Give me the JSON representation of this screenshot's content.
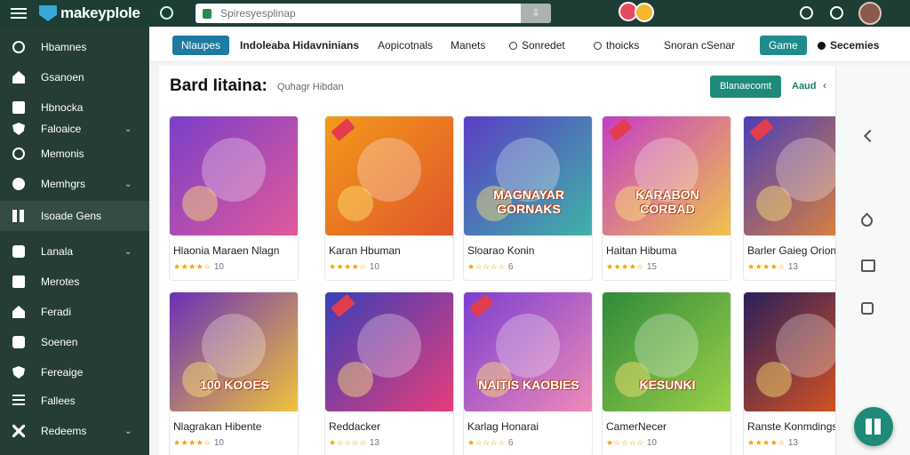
{
  "app": {
    "name": "makeyplole"
  },
  "search": {
    "placeholder": "Spiresyesplinap"
  },
  "sidebar": {
    "items": [
      {
        "label": "Hbamnes",
        "icon": "search-icon",
        "chevron": false,
        "active": false
      },
      {
        "label": "Gsanoen",
        "icon": "home-icon",
        "chevron": false,
        "active": false
      },
      {
        "label": "Hbnocka",
        "icon": "document-icon",
        "chevron": false,
        "active": false
      },
      {
        "label": "Faloaice",
        "icon": "shield-icon",
        "chevron": true,
        "active": false
      },
      {
        "label": "Memonis",
        "icon": "circle-icon",
        "chevron": false,
        "active": false
      },
      {
        "label": "Memhgrs",
        "icon": "dot-icon",
        "chevron": true,
        "active": false
      },
      {
        "label": "Isoade Gens",
        "icon": "grid-icon",
        "chevron": false,
        "active": true
      },
      {
        "label": "Lanala",
        "icon": "trash-icon",
        "chevron": true,
        "active": false
      },
      {
        "label": "Merotes",
        "icon": "edit-icon",
        "chevron": false,
        "active": false
      },
      {
        "label": "Feradi",
        "icon": "home-icon",
        "chevron": false,
        "active": false
      },
      {
        "label": "Soenen",
        "icon": "car-icon",
        "chevron": false,
        "active": false
      },
      {
        "label": "Fereaige",
        "icon": "tag-icon",
        "chevron": false,
        "active": false
      },
      {
        "label": "Fallees",
        "icon": "list-icon",
        "chevron": false,
        "active": false
      },
      {
        "label": "Redeems",
        "icon": "tools-icon",
        "chevron": true,
        "active": false
      }
    ]
  },
  "tabs": [
    {
      "label": "Nlaupes",
      "style": "pill-blue",
      "icon": null
    },
    {
      "label": "Indoleaba Hidavninians",
      "style": "text-bold",
      "icon": null
    },
    {
      "label": "Aopicotnals",
      "style": "text",
      "icon": null
    },
    {
      "label": "Manets",
      "style": "text",
      "icon": null
    },
    {
      "label": "Sonredet",
      "style": "text",
      "icon": "circle-icon"
    },
    {
      "label": "thoicks",
      "style": "text",
      "icon": "search-icon"
    },
    {
      "label": "Snoran cSenar",
      "style": "text",
      "icon": null
    },
    {
      "label": "Game",
      "style": "pill-teal",
      "icon": null
    },
    {
      "label": "Secemies",
      "style": "text-bold",
      "icon": "dot-icon"
    }
  ],
  "page": {
    "title": "Bard Iitaina:",
    "subtitle": "Quhagr Hibdan",
    "primary_button": "Blanaecomt",
    "secondary_action": "Aaud",
    "secondary_glyph": "‹"
  },
  "games": [
    {
      "title": "Hlaonia Maraen Nlagn",
      "rating_count": "10",
      "stars": 4,
      "caption": "",
      "colors": [
        "#7a3fc9",
        "#e25a9a"
      ],
      "ribbon": false
    },
    {
      "title": "Karan Hbuman",
      "rating_count": "10",
      "stars": 4,
      "caption": "",
      "colors": [
        "#f39a1a",
        "#e0552b"
      ],
      "ribbon": true
    },
    {
      "title": "Sloarao Konin",
      "rating_count": "6",
      "stars": 1,
      "caption": "MAGNAYAR GORNAKS",
      "colors": [
        "#5a3dc4",
        "#3fb4a8"
      ],
      "ribbon": false
    },
    {
      "title": "Haitan Hibuma",
      "rating_count": "15",
      "stars": 4,
      "caption": "KARABON CORBAD",
      "colors": [
        "#c43dc9",
        "#f0c44a"
      ],
      "ribbon": true
    },
    {
      "title": "Barler Gaieg Orion",
      "rating_count": "13",
      "stars": 4,
      "caption": "",
      "colors": [
        "#4a3fb8",
        "#f08a2b"
      ],
      "ribbon": true
    },
    {
      "title": "Nlagrakan Hibente",
      "rating_count": "10",
      "stars": 4,
      "caption": "100 KOOES",
      "colors": [
        "#6b2fb8",
        "#f0c43a"
      ],
      "ribbon": false
    },
    {
      "title": "Reddacker",
      "rating_count": "13",
      "stars": 1,
      "caption": "",
      "colors": [
        "#3a3fb8",
        "#e83d7a"
      ],
      "ribbon": true
    },
    {
      "title": "Karlag Honarai",
      "rating_count": "6",
      "stars": 1,
      "caption": "NAITIS KAOBIES",
      "colors": [
        "#7b3fd0",
        "#f08ab8"
      ],
      "ribbon": true
    },
    {
      "title": "CamerNecer",
      "rating_count": "10",
      "stars": 1,
      "caption": "KESUNKI",
      "colors": [
        "#2f8a3a",
        "#9cd04a"
      ],
      "ribbon": false
    },
    {
      "title": "Ranste Konmdings",
      "rating_count": "13",
      "stars": 4,
      "caption": "",
      "colors": [
        "#2a1f5a",
        "#f05a1a"
      ],
      "ribbon": false
    }
  ],
  "rail": {
    "icons": [
      "back-icon",
      "drop-icon",
      "folder-icon",
      "square-icon"
    ]
  },
  "fab": {
    "icon": "grid-icon"
  },
  "colors": {
    "topbar": "#1d3d35",
    "sidebar": "#253d35",
    "accent": "#1f8a78",
    "tab_blue": "#1d7aa0"
  }
}
